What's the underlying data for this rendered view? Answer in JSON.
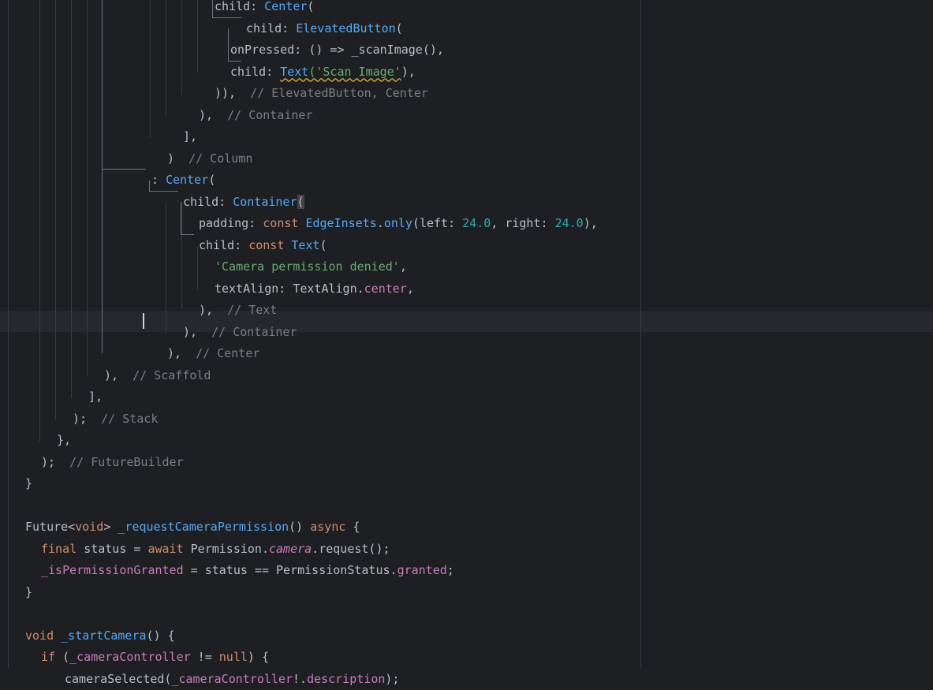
{
  "editor": {
    "lines": [
      [
        {
          "t": "child: ",
          "c": "plain"
        },
        {
          "t": "Center",
          "c": "cls"
        },
        {
          "t": "(",
          "c": "plain"
        }
      ],
      [
        {
          "t": "child: ",
          "c": "plain"
        },
        {
          "t": "ElevatedButton",
          "c": "cls"
        },
        {
          "t": "(",
          "c": "plain"
        }
      ],
      [
        {
          "t": "onPressed: () => _scanImage(),",
          "c": "plain"
        }
      ],
      [
        {
          "t": "child: ",
          "c": "plain"
        },
        {
          "t": "Text",
          "c": "cls",
          "squiggle": true
        },
        {
          "t": "('Scan Image'",
          "c": "str",
          "squiggle": true
        },
        {
          "t": "),",
          "c": "plain"
        }
      ],
      [
        {
          "t": ")),  ",
          "c": "plain"
        },
        {
          "t": "// ElevatedButton, Center",
          "c": "cmt"
        }
      ],
      [
        {
          "t": "),  ",
          "c": "plain"
        },
        {
          "t": "// Container",
          "c": "cmt"
        }
      ],
      [
        {
          "t": "],",
          "c": "plain"
        }
      ],
      [
        {
          "t": ")  ",
          "c": "plain"
        },
        {
          "t": "// Column",
          "c": "cmt"
        }
      ],
      [
        {
          "t": ": ",
          "c": "plain"
        },
        {
          "t": "Center",
          "c": "cls"
        },
        {
          "t": "(",
          "c": "plain"
        }
      ],
      [
        {
          "t": "child: ",
          "c": "plain"
        },
        {
          "t": "Container",
          "c": "cls"
        },
        {
          "t": "(",
          "c": "plain",
          "hl": true
        }
      ],
      [
        {
          "t": "padding: ",
          "c": "plain"
        },
        {
          "t": "const ",
          "c": "kw"
        },
        {
          "t": "EdgeInsets",
          "c": "cls"
        },
        {
          "t": ".",
          "c": "plain"
        },
        {
          "t": "only",
          "c": "fn"
        },
        {
          "t": "(left: ",
          "c": "plain"
        },
        {
          "t": "24.0",
          "c": "num"
        },
        {
          "t": ", right: ",
          "c": "plain"
        },
        {
          "t": "24.0",
          "c": "num"
        },
        {
          "t": "),",
          "c": "plain"
        }
      ],
      [
        {
          "t": "child: ",
          "c": "plain"
        },
        {
          "t": "const ",
          "c": "kw"
        },
        {
          "t": "Text",
          "c": "cls"
        },
        {
          "t": "(",
          "c": "plain"
        }
      ],
      [
        {
          "t": "'Camera permission denied'",
          "c": "str"
        },
        {
          "t": ",",
          "c": "plain"
        }
      ],
      [
        {
          "t": "textAlign: TextAlign.",
          "c": "plain"
        },
        {
          "t": "center",
          "c": "prop"
        },
        {
          "t": ",",
          "c": "plain"
        }
      ],
      [
        {
          "t": "),  ",
          "c": "plain"
        },
        {
          "t": "// Text",
          "c": "cmt"
        }
      ],
      [
        {
          "t": "),  ",
          "c": "plain"
        },
        {
          "t": "// Container",
          "c": "cmt"
        }
      ],
      [
        {
          "t": "),  ",
          "c": "plain"
        },
        {
          "t": "// Center",
          "c": "cmt"
        }
      ],
      [
        {
          "t": "),  ",
          "c": "plain"
        },
        {
          "t": "// Scaffold",
          "c": "cmt"
        }
      ],
      [
        {
          "t": "],",
          "c": "plain"
        }
      ],
      [
        {
          "t": ");  ",
          "c": "plain"
        },
        {
          "t": "// Stack",
          "c": "cmt"
        }
      ],
      [
        {
          "t": "},",
          "c": "plain"
        }
      ],
      [
        {
          "t": ");  ",
          "c": "plain"
        },
        {
          "t": "// FutureBuilder",
          "c": "cmt"
        }
      ],
      [
        {
          "t": "}",
          "c": "plain"
        }
      ],
      [],
      [
        {
          "t": "Future<",
          "c": "plain"
        },
        {
          "t": "void",
          "c": "kw"
        },
        {
          "t": "> ",
          "c": "plain"
        },
        {
          "t": "_requestCameraPermission",
          "c": "fn"
        },
        {
          "t": "() ",
          "c": "plain"
        },
        {
          "t": "async",
          "c": "kw"
        },
        {
          "t": " {",
          "c": "plain"
        }
      ],
      [
        {
          "t": "final ",
          "c": "kw"
        },
        {
          "t": "status = ",
          "c": "plain"
        },
        {
          "t": "await ",
          "c": "kw"
        },
        {
          "t": "Permission.",
          "c": "plain"
        },
        {
          "t": "camera",
          "c": "ital"
        },
        {
          "t": ".request();",
          "c": "plain"
        }
      ],
      [
        {
          "t": "_isPermissionGranted",
          "c": "field"
        },
        {
          "t": " = status == PermissionStatus.",
          "c": "plain"
        },
        {
          "t": "granted",
          "c": "prop"
        },
        {
          "t": ";",
          "c": "plain"
        }
      ],
      [
        {
          "t": "}",
          "c": "plain"
        }
      ],
      [],
      [
        {
          "t": "void ",
          "c": "kw"
        },
        {
          "t": "_startCamera",
          "c": "fn"
        },
        {
          "t": "() {",
          "c": "plain"
        }
      ],
      [
        {
          "t": "if ",
          "c": "kw"
        },
        {
          "t": "(",
          "c": "plain"
        },
        {
          "t": "_cameraController",
          "c": "field"
        },
        {
          "t": " != ",
          "c": "plain"
        },
        {
          "t": "null",
          "c": "kw"
        },
        {
          "t": ") {",
          "c": "plain"
        }
      ],
      [
        {
          "t": "cameraSelected(",
          "c": "plain"
        },
        {
          "t": "_cameraController",
          "c": "field"
        },
        {
          "t": "!.",
          "c": "plain"
        },
        {
          "t": "description",
          "c": "field"
        },
        {
          "t": ");",
          "c": "plain"
        }
      ]
    ]
  }
}
